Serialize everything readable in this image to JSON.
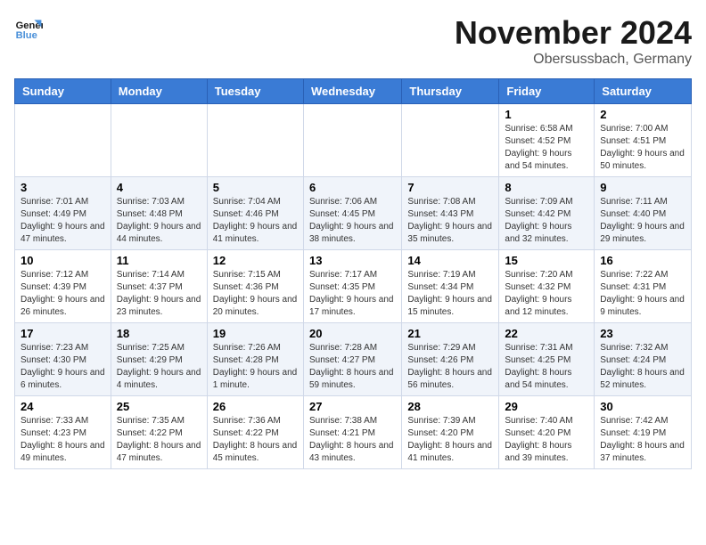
{
  "logo": {
    "line1": "General",
    "line2": "Blue"
  },
  "title": "November 2024",
  "location": "Obersussbach, Germany",
  "headers": [
    "Sunday",
    "Monday",
    "Tuesday",
    "Wednesday",
    "Thursday",
    "Friday",
    "Saturday"
  ],
  "weeks": [
    [
      {
        "day": "",
        "info": ""
      },
      {
        "day": "",
        "info": ""
      },
      {
        "day": "",
        "info": ""
      },
      {
        "day": "",
        "info": ""
      },
      {
        "day": "",
        "info": ""
      },
      {
        "day": "1",
        "info": "Sunrise: 6:58 AM\nSunset: 4:52 PM\nDaylight: 9 hours and 54 minutes."
      },
      {
        "day": "2",
        "info": "Sunrise: 7:00 AM\nSunset: 4:51 PM\nDaylight: 9 hours and 50 minutes."
      }
    ],
    [
      {
        "day": "3",
        "info": "Sunrise: 7:01 AM\nSunset: 4:49 PM\nDaylight: 9 hours and 47 minutes."
      },
      {
        "day": "4",
        "info": "Sunrise: 7:03 AM\nSunset: 4:48 PM\nDaylight: 9 hours and 44 minutes."
      },
      {
        "day": "5",
        "info": "Sunrise: 7:04 AM\nSunset: 4:46 PM\nDaylight: 9 hours and 41 minutes."
      },
      {
        "day": "6",
        "info": "Sunrise: 7:06 AM\nSunset: 4:45 PM\nDaylight: 9 hours and 38 minutes."
      },
      {
        "day": "7",
        "info": "Sunrise: 7:08 AM\nSunset: 4:43 PM\nDaylight: 9 hours and 35 minutes."
      },
      {
        "day": "8",
        "info": "Sunrise: 7:09 AM\nSunset: 4:42 PM\nDaylight: 9 hours and 32 minutes."
      },
      {
        "day": "9",
        "info": "Sunrise: 7:11 AM\nSunset: 4:40 PM\nDaylight: 9 hours and 29 minutes."
      }
    ],
    [
      {
        "day": "10",
        "info": "Sunrise: 7:12 AM\nSunset: 4:39 PM\nDaylight: 9 hours and 26 minutes."
      },
      {
        "day": "11",
        "info": "Sunrise: 7:14 AM\nSunset: 4:37 PM\nDaylight: 9 hours and 23 minutes."
      },
      {
        "day": "12",
        "info": "Sunrise: 7:15 AM\nSunset: 4:36 PM\nDaylight: 9 hours and 20 minutes."
      },
      {
        "day": "13",
        "info": "Sunrise: 7:17 AM\nSunset: 4:35 PM\nDaylight: 9 hours and 17 minutes."
      },
      {
        "day": "14",
        "info": "Sunrise: 7:19 AM\nSunset: 4:34 PM\nDaylight: 9 hours and 15 minutes."
      },
      {
        "day": "15",
        "info": "Sunrise: 7:20 AM\nSunset: 4:32 PM\nDaylight: 9 hours and 12 minutes."
      },
      {
        "day": "16",
        "info": "Sunrise: 7:22 AM\nSunset: 4:31 PM\nDaylight: 9 hours and 9 minutes."
      }
    ],
    [
      {
        "day": "17",
        "info": "Sunrise: 7:23 AM\nSunset: 4:30 PM\nDaylight: 9 hours and 6 minutes."
      },
      {
        "day": "18",
        "info": "Sunrise: 7:25 AM\nSunset: 4:29 PM\nDaylight: 9 hours and 4 minutes."
      },
      {
        "day": "19",
        "info": "Sunrise: 7:26 AM\nSunset: 4:28 PM\nDaylight: 9 hours and 1 minute."
      },
      {
        "day": "20",
        "info": "Sunrise: 7:28 AM\nSunset: 4:27 PM\nDaylight: 8 hours and 59 minutes."
      },
      {
        "day": "21",
        "info": "Sunrise: 7:29 AM\nSunset: 4:26 PM\nDaylight: 8 hours and 56 minutes."
      },
      {
        "day": "22",
        "info": "Sunrise: 7:31 AM\nSunset: 4:25 PM\nDaylight: 8 hours and 54 minutes."
      },
      {
        "day": "23",
        "info": "Sunrise: 7:32 AM\nSunset: 4:24 PM\nDaylight: 8 hours and 52 minutes."
      }
    ],
    [
      {
        "day": "24",
        "info": "Sunrise: 7:33 AM\nSunset: 4:23 PM\nDaylight: 8 hours and 49 minutes."
      },
      {
        "day": "25",
        "info": "Sunrise: 7:35 AM\nSunset: 4:22 PM\nDaylight: 8 hours and 47 minutes."
      },
      {
        "day": "26",
        "info": "Sunrise: 7:36 AM\nSunset: 4:22 PM\nDaylight: 8 hours and 45 minutes."
      },
      {
        "day": "27",
        "info": "Sunrise: 7:38 AM\nSunset: 4:21 PM\nDaylight: 8 hours and 43 minutes."
      },
      {
        "day": "28",
        "info": "Sunrise: 7:39 AM\nSunset: 4:20 PM\nDaylight: 8 hours and 41 minutes."
      },
      {
        "day": "29",
        "info": "Sunrise: 7:40 AM\nSunset: 4:20 PM\nDaylight: 8 hours and 39 minutes."
      },
      {
        "day": "30",
        "info": "Sunrise: 7:42 AM\nSunset: 4:19 PM\nDaylight: 8 hours and 37 minutes."
      }
    ]
  ]
}
